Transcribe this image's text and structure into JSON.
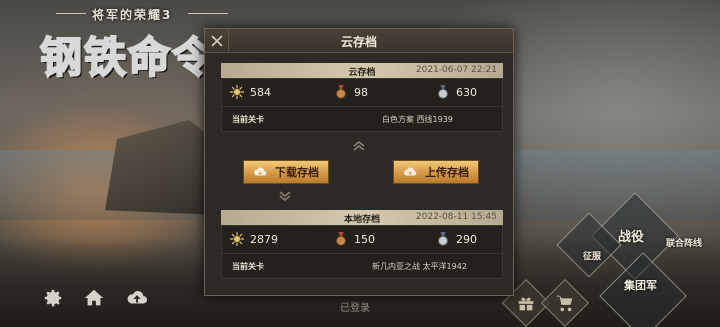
{
  "game": {
    "subtitle": "将军的荣耀3",
    "title": "钢铁命令"
  },
  "dialog": {
    "title": "云存档",
    "cloud": {
      "label": "云存档",
      "date": "2021-06-07 22:21",
      "stats": {
        "medal": "584",
        "bronze": "98",
        "silver": "630"
      },
      "level_label": "当前关卡",
      "level_value": "白色方案  西线1939"
    },
    "download_label": "下载存档",
    "upload_label": "上传存档",
    "local": {
      "label": "本地存档",
      "date": "2022-08-11 15:45",
      "stats": {
        "medal": "2879",
        "bronze": "150",
        "silver": "290"
      },
      "level_label": "当前关卡",
      "level_value": "新几内亚之战  太平洋1942"
    }
  },
  "footer": {
    "status": "已登录"
  },
  "menu": {
    "campaign": "战役",
    "conquest": "征服",
    "united_front": "联合阵线",
    "army_group": "集团军"
  },
  "icons": [
    "gear-icon",
    "home-icon",
    "cloud-upload-icon",
    "gift-icon",
    "cart-icon"
  ],
  "colors": {
    "accent_gold": "#d49a45",
    "panel": "#2d2924",
    "header_bar": "#d4c8ae"
  }
}
